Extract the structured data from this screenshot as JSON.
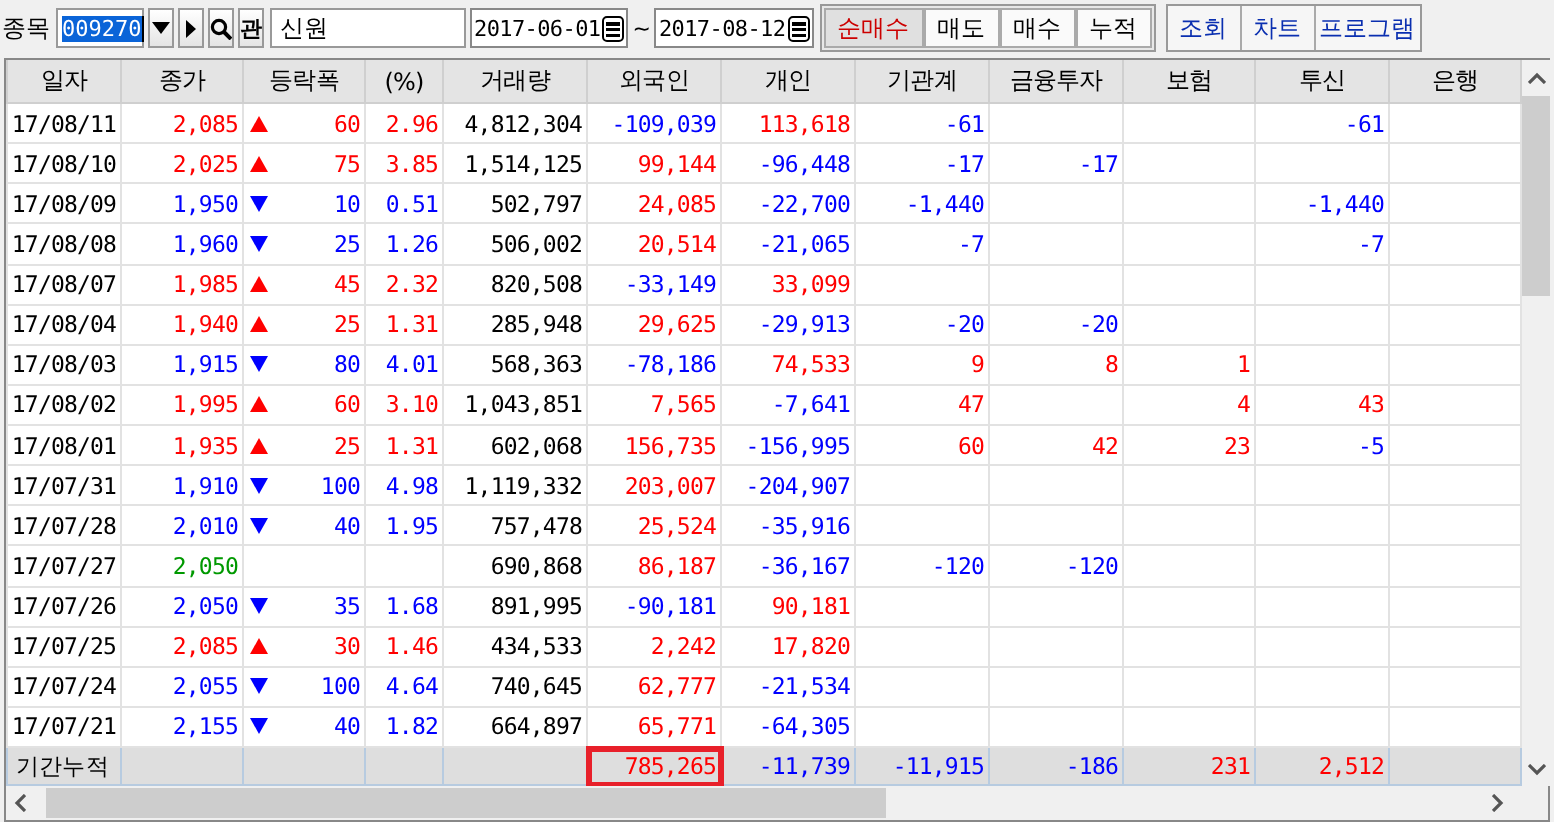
{
  "toolbar": {
    "stock_label": "종목",
    "stock_code": "009270",
    "stock_name": "신원",
    "name_button": "관",
    "start_date": "2017-06-01",
    "date_separator": "~",
    "end_date": "2017-08-12",
    "modes": [
      {
        "label": "순매수",
        "selected": true
      },
      {
        "label": "매도",
        "selected": false
      },
      {
        "label": "매수",
        "selected": false
      },
      {
        "label": "누적",
        "selected": false
      }
    ],
    "actions": [
      "조회",
      "차트",
      "프로그램"
    ]
  },
  "table": {
    "columns": [
      "일자",
      "종가",
      "등락폭",
      "(%)",
      "거래량",
      "외국인",
      "개인",
      "기관계",
      "금융투자",
      "보험",
      "투신",
      "은행"
    ],
    "rows": [
      {
        "date": "17/08/11",
        "close": "2,085",
        "rising": true,
        "unchanged": false,
        "change": "60",
        "pct": "2.96",
        "volume": "4,812,304",
        "investors": {
          "foreign": "-109,039",
          "individual": "113,618",
          "institution": "-61",
          "trust": "-61"
        }
      },
      {
        "date": "17/08/10",
        "close": "2,025",
        "rising": true,
        "unchanged": false,
        "change": "75",
        "pct": "3.85",
        "volume": "1,514,125",
        "investors": {
          "foreign": "99,144",
          "individual": "-96,448",
          "institution": "-17",
          "financial": "-17"
        }
      },
      {
        "date": "17/08/09",
        "close": "1,950",
        "rising": false,
        "unchanged": false,
        "change": "10",
        "pct": "0.51",
        "volume": "502,797",
        "investors": {
          "foreign": "24,085",
          "individual": "-22,700",
          "institution": "-1,440",
          "trust": "-1,440"
        }
      },
      {
        "date": "17/08/08",
        "close": "1,960",
        "rising": false,
        "unchanged": false,
        "change": "25",
        "pct": "1.26",
        "volume": "506,002",
        "investors": {
          "foreign": "20,514",
          "individual": "-21,065",
          "institution": "-7",
          "trust": "-7"
        }
      },
      {
        "date": "17/08/07",
        "close": "1,985",
        "rising": true,
        "unchanged": false,
        "change": "45",
        "pct": "2.32",
        "volume": "820,508",
        "investors": {
          "foreign": "-33,149",
          "individual": "33,099"
        }
      },
      {
        "date": "17/08/04",
        "close": "1,940",
        "rising": true,
        "unchanged": false,
        "change": "25",
        "pct": "1.31",
        "volume": "285,948",
        "investors": {
          "foreign": "29,625",
          "individual": "-29,913",
          "institution": "-20",
          "financial": "-20"
        }
      },
      {
        "date": "17/08/03",
        "close": "1,915",
        "rising": false,
        "unchanged": false,
        "change": "80",
        "pct": "4.01",
        "volume": "568,363",
        "investors": {
          "foreign": "-78,186",
          "individual": "74,533",
          "institution": "9",
          "financial": "8",
          "insurance": "1"
        }
      },
      {
        "date": "17/08/02",
        "close": "1,995",
        "rising": true,
        "unchanged": false,
        "change": "60",
        "pct": "3.10",
        "volume": "1,043,851",
        "investors": {
          "foreign": "7,565",
          "individual": "-7,641",
          "institution": "47",
          "insurance": "4",
          "trust": "43"
        }
      },
      {
        "date": "17/08/01",
        "close": "1,935",
        "rising": true,
        "unchanged": false,
        "change": "25",
        "pct": "1.31",
        "volume": "602,068",
        "investors": {
          "foreign": "156,735",
          "individual": "-156,995",
          "institution": "60",
          "financial": "42",
          "insurance": "23",
          "trust": "-5"
        }
      },
      {
        "date": "17/07/31",
        "close": "1,910",
        "rising": false,
        "unchanged": false,
        "change": "100",
        "pct": "4.98",
        "volume": "1,119,332",
        "investors": {
          "foreign": "203,007",
          "individual": "-204,907"
        }
      },
      {
        "date": "17/07/28",
        "close": "2,010",
        "rising": false,
        "unchanged": false,
        "change": "40",
        "pct": "1.95",
        "volume": "757,478",
        "investors": {
          "foreign": "25,524",
          "individual": "-35,916"
        }
      },
      {
        "date": "17/07/27",
        "close": "2,050",
        "unchanged": true,
        "volume": "690,868",
        "investors": {
          "foreign": "86,187",
          "individual": "-36,167",
          "institution": "-120",
          "financial": "-120"
        }
      },
      {
        "date": "17/07/26",
        "close": "2,050",
        "rising": false,
        "unchanged": false,
        "change": "35",
        "pct": "1.68",
        "volume": "891,995",
        "investors": {
          "foreign": "-90,181",
          "individual": "90,181"
        }
      },
      {
        "date": "17/07/25",
        "close": "2,085",
        "rising": true,
        "unchanged": false,
        "change": "30",
        "pct": "1.46",
        "volume": "434,533",
        "investors": {
          "foreign": "2,242",
          "individual": "17,820"
        }
      },
      {
        "date": "17/07/24",
        "close": "2,055",
        "rising": false,
        "unchanged": false,
        "change": "100",
        "pct": "4.64",
        "volume": "740,645",
        "investors": {
          "foreign": "62,777",
          "individual": "-21,534"
        }
      },
      {
        "date": "17/07/21",
        "close": "2,155",
        "rising": false,
        "unchanged": false,
        "change": "40",
        "pct": "1.82",
        "volume": "664,897",
        "investors": {
          "foreign": "65,771",
          "individual": "-64,305"
        }
      }
    ],
    "summary": {
      "label": "기간누적",
      "investors": [
        {
          "value": "785,265",
          "highlighted": true
        },
        {
          "value": "-11,739",
          "highlighted": false
        },
        {
          "value": "-11,915",
          "highlighted": false
        },
        {
          "value": "-186",
          "highlighted": false
        },
        {
          "value": "231",
          "highlighted": false
        },
        {
          "value": "2,512",
          "highlighted": false
        }
      ]
    }
  }
}
